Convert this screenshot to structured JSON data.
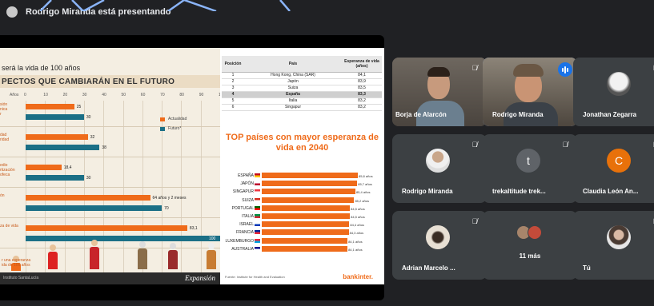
{
  "banner": {
    "presenter_text": "Rodrigo Miranda está presentando"
  },
  "slide_left": {
    "title": "será la vida de 100 años",
    "subtitle": "PECTOS QUE CAMBIARÁN EN EL FUTURO",
    "axis_label": "Años",
    "axis_ticks": [
      "0",
      "10",
      "20",
      "30",
      "40",
      "50",
      "60",
      "70",
      "80",
      "90",
      "1"
    ],
    "row_labels": [
      "sión\nnica\nr",
      "dad\nridad",
      "edio\nrtización\nofeca",
      "ón",
      "za de vida"
    ],
    "bars": [
      {
        "actual": 25,
        "future": 30,
        "actual_label": "25",
        "future_label": "30"
      },
      {
        "actual": 32,
        "future": 38,
        "actual_label": "32",
        "future_label": "38"
      },
      {
        "actual": 18.4,
        "future": 30,
        "actual_label": "18,4",
        "future_label": "30"
      },
      {
        "actual": 64,
        "future": 70,
        "actual_label": "64 años y 2 meses",
        "future_label": "70"
      },
      {
        "actual": 83.1,
        "future": 100,
        "actual_label": "83,1",
        "future_label": "100"
      }
    ],
    "legend": [
      "Actualidad",
      "Futuro*"
    ],
    "note": "r una esperanza\nida de 100 años",
    "footer_source": "Instituto SantaLucía",
    "footer_brand": "Expansión"
  },
  "slide_right": {
    "table_headers": [
      "Posición",
      "País",
      "Esperanza de vida (años)"
    ],
    "table_rows": [
      [
        "1",
        "Hong Kong, China (SAR)",
        "84,1"
      ],
      [
        "2",
        "Japón",
        "83,9"
      ],
      [
        "3",
        "Suiza",
        "83,5"
      ],
      [
        "4",
        "España",
        "83,3"
      ],
      [
        "5",
        "Italia",
        "83,2"
      ],
      [
        "6",
        "Singapur",
        "83,2"
      ]
    ],
    "highlight_row": 3,
    "top_title": "TOP países con mayor esperanza de vida en 2040",
    "top_countries": [
      {
        "name": "ESPAÑA",
        "value": 85.8,
        "label": "85,8 años",
        "flag": [
          "#c60b1e",
          "#ffc400"
        ]
      },
      {
        "name": "JAPÓN",
        "value": 85.7,
        "label": "85,7 años",
        "flag": [
          "#ffffff",
          "#bc002d"
        ]
      },
      {
        "name": "SINGAPUR",
        "value": 85.4,
        "label": "85,4 años",
        "flag": [
          "#ef3340",
          "#ffffff"
        ]
      },
      {
        "name": "SUIZA",
        "value": 85.2,
        "label": "85,2 años",
        "flag": [
          "#d52b1e",
          "#ffffff"
        ]
      },
      {
        "name": "PORTUGAL",
        "value": 84.5,
        "label": "84,5 años",
        "flag": [
          "#006600",
          "#ff0000"
        ]
      },
      {
        "name": "ITALIA",
        "value": 84.5,
        "label": "84,5 años",
        "flag": [
          "#009246",
          "#ce2b37"
        ]
      },
      {
        "name": "ISRAEL",
        "value": 84.4,
        "label": "84,4 años",
        "flag": [
          "#ffffff",
          "#0038b8"
        ]
      },
      {
        "name": "FRANCIA",
        "value": 84.3,
        "label": "84,3 años",
        "flag": [
          "#002395",
          "#ed2939"
        ]
      },
      {
        "name": "LUXEMBURGO",
        "value": 84.1,
        "label": "84,1 años",
        "flag": [
          "#ed2939",
          "#00a1de"
        ]
      },
      {
        "name": "AUSTRALIA",
        "value": 84.1,
        "label": "84,1 años",
        "flag": [
          "#00008b",
          "#ffffff"
        ]
      }
    ],
    "footer_source": "Fuente: Institute for Health and Evaluation",
    "footer_brand": "bankinter."
  },
  "participants": [
    {
      "name": "Borja de Alarcón",
      "type": "video",
      "muted": true
    },
    {
      "name": "Rodrigo Miranda",
      "type": "video",
      "speaking": true
    },
    {
      "name": "Jonathan Zegarra",
      "type": "avatar",
      "muted": true
    },
    {
      "name": "Rodrigo Miranda",
      "type": "avatar",
      "muted": true
    },
    {
      "name": "trekaltitude trek...",
      "type": "letter",
      "letter": "t",
      "muted": true
    },
    {
      "name": "Claudia León An...",
      "type": "letter",
      "letter": "C",
      "muted": true
    },
    {
      "name": "Adrian Marcelo ...",
      "type": "avatar",
      "muted": true
    },
    {
      "name": "11 más",
      "type": "more"
    },
    {
      "name": "Tú",
      "type": "avatar",
      "muted": true
    }
  ],
  "colors": {
    "accent_orange": "#ef6b1a",
    "teal": "#1b6f86",
    "speaking_blue": "#1a73e8",
    "tile_bg": "#3c4043",
    "claudia_avatar": "#e8710a",
    "trek_avatar": "#5f6368"
  },
  "icons": {
    "mute": "mic-off-icon",
    "speaking": "audio-level-icon"
  }
}
